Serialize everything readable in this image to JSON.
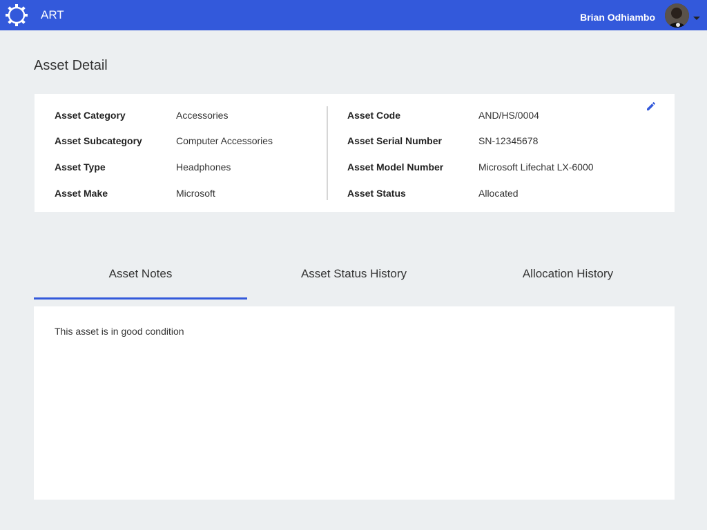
{
  "header": {
    "app_title": "ART",
    "user_name": "Brian Odhiambo",
    "logo_icon": "gear-logo-icon",
    "avatar_icon": "user-avatar",
    "accent_color": "#3359db"
  },
  "page": {
    "title": "Asset Detail"
  },
  "asset": {
    "left_fields": [
      {
        "label": "Asset Category",
        "value": "Accessories"
      },
      {
        "label": "Asset Subcategory",
        "value": "Computer Accessories"
      },
      {
        "label": "Asset Type",
        "value": "Headphones"
      },
      {
        "label": "Asset Make",
        "value": "Microsoft"
      }
    ],
    "right_fields": [
      {
        "label": "Asset Code",
        "value": "AND/HS/0004"
      },
      {
        "label": "Asset Serial Number",
        "value": "SN-12345678"
      },
      {
        "label": "Asset Model Number",
        "value": "Microsoft Lifechat LX-6000"
      },
      {
        "label": "Asset Status",
        "value": "Allocated"
      }
    ],
    "edit_icon": "pencil-icon"
  },
  "tabs": [
    {
      "label": "Asset Notes",
      "active": true
    },
    {
      "label": "Asset Status History",
      "active": false
    },
    {
      "label": "Allocation History",
      "active": false
    }
  ],
  "notes": {
    "text": "This asset is in good condition"
  }
}
